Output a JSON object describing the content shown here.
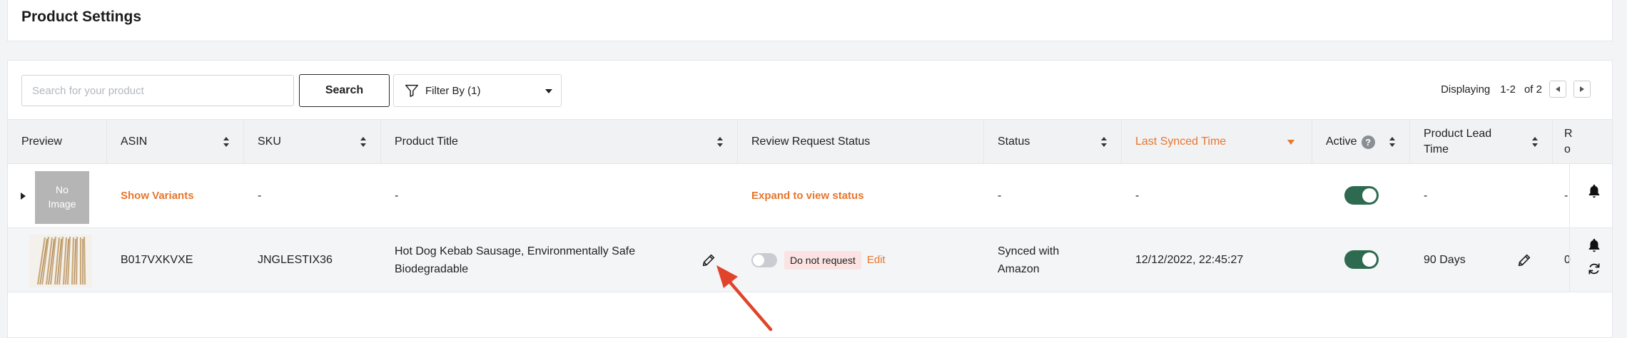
{
  "header": {
    "title": "Product Settings"
  },
  "toolbar": {
    "search_placeholder": "Search for your product",
    "search_label": "Search",
    "filter_label": "Filter By (1)"
  },
  "pagination": {
    "label": "Displaying",
    "range": "1-2",
    "of_text": "of 2"
  },
  "table": {
    "columns": {
      "preview": "Preview",
      "asin": "ASIN",
      "sku": "SKU",
      "product_title": "Product Title",
      "review_request_status": "Review Request Status",
      "status": "Status",
      "last_synced_time": "Last Synced Time",
      "active": "Active",
      "lead_time_1": "Product Lead",
      "lead_time_2": "Time",
      "truncated_1": "R",
      "truncated_2": "o"
    },
    "rows": [
      {
        "preview": {
          "line1": "No",
          "line2": "Image"
        },
        "asin": "Show Variants",
        "sku": "-",
        "title": "-",
        "review": "Expand to view status",
        "status": "-",
        "synced": "-",
        "lead": "-",
        "truncated": "-"
      },
      {
        "asin": "B017VXKVXE",
        "sku": "JNGLESTIX36",
        "title_line1": "Hot Dog Kebab Sausage, Environmentally Safe",
        "title_line2": "Biodegradable",
        "review_pill": "Do not request",
        "review_edit": "Edit",
        "status_line1": "Synced with",
        "status_line2": "Amazon",
        "synced": "12/12/2022, 22:45:27",
        "lead": "90 Days",
        "truncated": "0"
      }
    ]
  },
  "colors": {
    "accent": "#e8762d",
    "toggle_on": "#2d6a4f",
    "annotation_arrow": "#e0452b"
  }
}
